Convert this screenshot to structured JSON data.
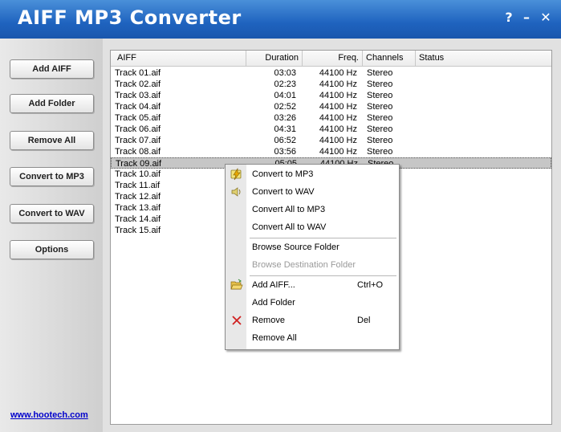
{
  "window": {
    "title": "AIFF MP3 Converter",
    "help_label": "?",
    "minimize_label": "–",
    "close_label": "✕"
  },
  "sidebar": {
    "buttons": [
      {
        "label": "Add AIFF"
      },
      {
        "label": "Add Folder"
      },
      {
        "label": "Remove All"
      },
      {
        "label": "Convert to MP3"
      },
      {
        "label": "Convert to WAV"
      },
      {
        "label": "Options"
      }
    ],
    "link": "www.hootech.com"
  },
  "list": {
    "headers": {
      "name": "AIFF",
      "duration": "Duration",
      "freq": "Freq.",
      "channels": "Channels",
      "status": "Status"
    },
    "rows": [
      {
        "name": "Track 01.aif",
        "duration": "03:03",
        "freq": "44100 Hz",
        "channels": "Stereo"
      },
      {
        "name": "Track 02.aif",
        "duration": "02:23",
        "freq": "44100 Hz",
        "channels": "Stereo"
      },
      {
        "name": "Track 03.aif",
        "duration": "04:01",
        "freq": "44100 Hz",
        "channels": "Stereo"
      },
      {
        "name": "Track 04.aif",
        "duration": "02:52",
        "freq": "44100 Hz",
        "channels": "Stereo"
      },
      {
        "name": "Track 05.aif",
        "duration": "03:26",
        "freq": "44100 Hz",
        "channels": "Stereo"
      },
      {
        "name": "Track 06.aif",
        "duration": "04:31",
        "freq": "44100 Hz",
        "channels": "Stereo"
      },
      {
        "name": "Track 07.aif",
        "duration": "06:52",
        "freq": "44100 Hz",
        "channels": "Stereo"
      },
      {
        "name": "Track 08.aif",
        "duration": "03:56",
        "freq": "44100 Hz",
        "channels": "Stereo"
      },
      {
        "name": "Track 09.aif",
        "duration": "05:05",
        "freq": "44100 Hz",
        "channels": "Stereo"
      },
      {
        "name": "Track 10.aif",
        "duration": "",
        "freq": "",
        "channels": ""
      },
      {
        "name": "Track 11.aif",
        "duration": "",
        "freq": "",
        "channels": ""
      },
      {
        "name": "Track 12.aif",
        "duration": "",
        "freq": "",
        "channels": ""
      },
      {
        "name": "Track 13.aif",
        "duration": "",
        "freq": "",
        "channels": ""
      },
      {
        "name": "Track 14.aif",
        "duration": "",
        "freq": "",
        "channels": ""
      },
      {
        "name": "Track 15.aif",
        "duration": "",
        "freq": "",
        "channels": ""
      }
    ]
  },
  "context_menu": {
    "items": [
      {
        "label": "Convert to MP3",
        "shortcut": "",
        "icon": "lightning-icon"
      },
      {
        "label": "Convert to WAV",
        "shortcut": "",
        "icon": "speaker-icon"
      },
      {
        "label": "Convert All to MP3",
        "shortcut": ""
      },
      {
        "label": "Convert All to WAV",
        "shortcut": ""
      },
      {
        "label": "Browse Source Folder",
        "shortcut": ""
      },
      {
        "label": "Browse Destination Folder",
        "shortcut": "",
        "disabled": true
      },
      {
        "label": "Add AIFF...",
        "shortcut": "Ctrl+O",
        "icon": "folder-open-icon"
      },
      {
        "label": "Add Folder",
        "shortcut": ""
      },
      {
        "label": "Remove",
        "shortcut": "Del",
        "icon": "delete-x-icon"
      },
      {
        "label": "Remove All",
        "shortcut": ""
      }
    ]
  },
  "colors": {
    "titlebar": "#1f63bf",
    "selection": "#c6c6c6",
    "link": "#0000cc"
  }
}
